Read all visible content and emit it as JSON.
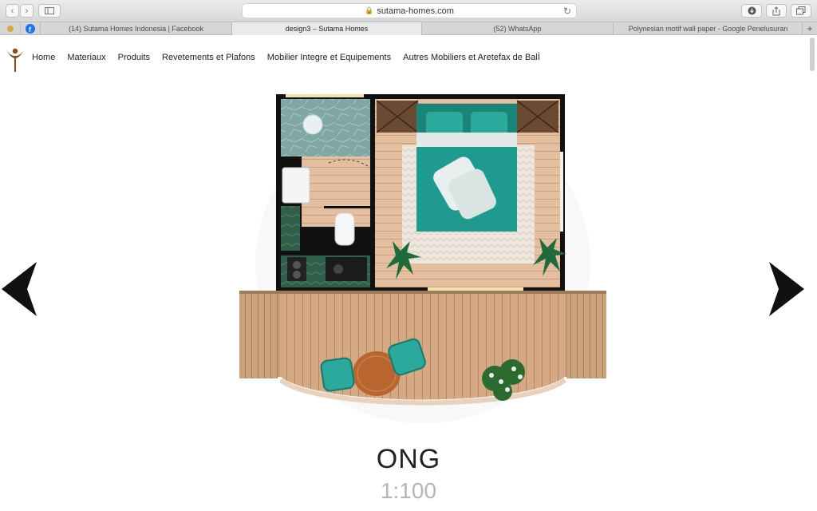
{
  "browser": {
    "url": "sutama-homes.com",
    "tabs": [
      {
        "label": "(14) Sutama Homes Indonesia | Facebook",
        "active": false
      },
      {
        "label": "design3 – Sutama Homes",
        "active": true
      },
      {
        "label": "(52) WhatsApp",
        "active": false
      },
      {
        "label": "Polynesian motif wall paper - Google Penelusuran",
        "active": false
      }
    ]
  },
  "nav": {
    "items": [
      "Home",
      "Materiaux",
      "Produits",
      "Revetements et Plafons",
      "Mobilier Integre et Equipements",
      "Autres Mobiliers et Aretefax de BalÌ"
    ]
  },
  "design": {
    "name": "ONG",
    "scale": "1:100"
  },
  "colors": {
    "accent": "#1f9a8e",
    "wood": "#d7a97f",
    "wall": "#111111"
  }
}
